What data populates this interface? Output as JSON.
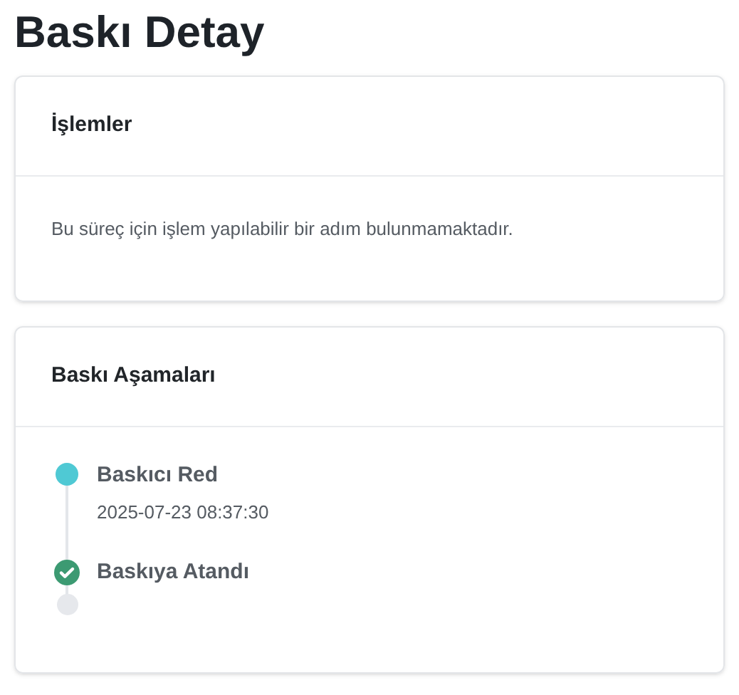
{
  "title": "Baskı Detay",
  "actions_card": {
    "title": "İşlemler",
    "message": "Bu süreç için işlem yapılabilir bir adım bulunmamaktadır."
  },
  "stages_card": {
    "title": "Baskı Aşamaları",
    "steps": [
      {
        "kind": "dot",
        "color": "#4fc9d4",
        "label": "Baskıcı Red",
        "time": "2025-07-23 08:37:30"
      },
      {
        "kind": "check",
        "color": "#3c9a72",
        "label": "Baskıya Atandı"
      }
    ]
  }
}
